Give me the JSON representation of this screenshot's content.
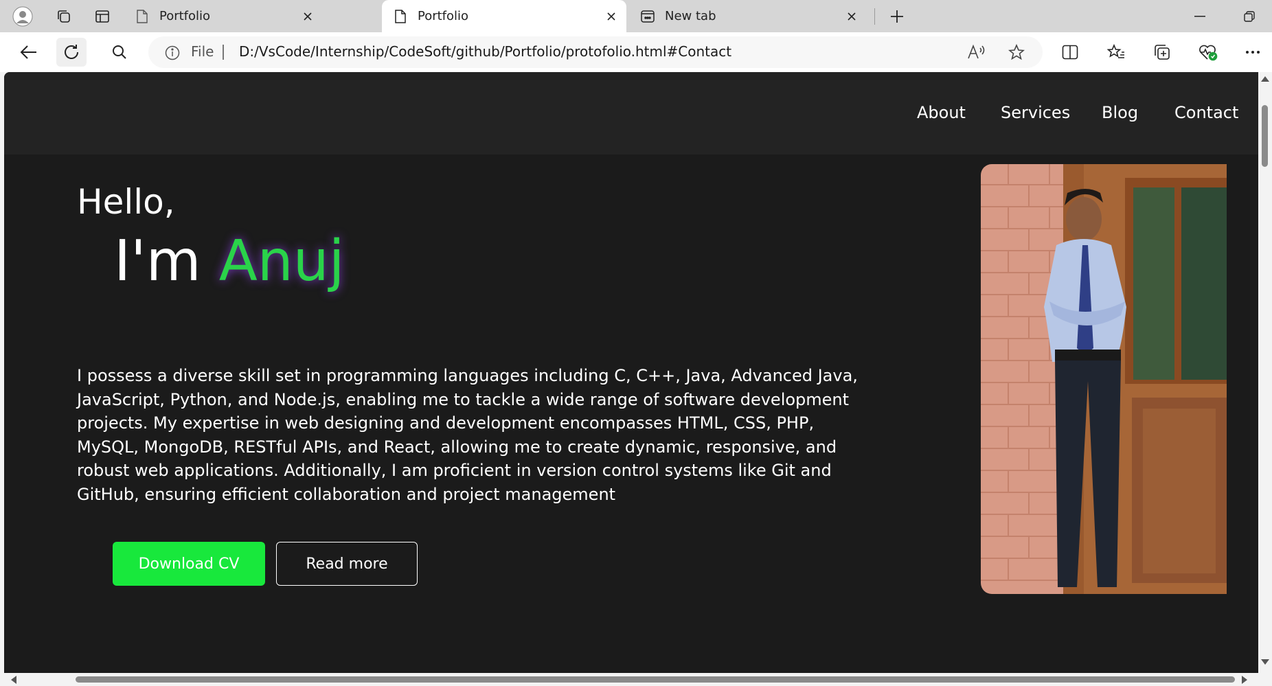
{
  "browser": {
    "tabs": [
      {
        "title": "Portfolio",
        "icon": "page-icon",
        "active": false
      },
      {
        "title": "Portfolio",
        "icon": "page-icon",
        "active": true
      },
      {
        "title": "New tab",
        "icon": "new-tab-page-icon",
        "active": false
      }
    ],
    "address_bar": {
      "protocol_label": "File",
      "url": "D:/VsCode/Internship/CodeSoft/github/Portfolio/protofolio.html#Contact"
    }
  },
  "page": {
    "nav": [
      "About",
      "Services",
      "Blog",
      "Contact"
    ],
    "hero": {
      "greeting": "Hello,",
      "intro_prefix": "I'm",
      "name": "Anuj",
      "bio": "I possess a diverse skill set in programming languages including C, C++, Java, Advanced Java, JavaScript, Python, and Node.js, enabling me to tackle a wide range of software development projects. My expertise in web designing and development encompasses HTML, CSS, PHP, MySQL, MongoDB, RESTful APIs, and React, allowing me to create dynamic, responsive, and robust web applications. Additionally, I am proficient in version control systems like Git and GitHub, ensuring efficient collaboration and project management",
      "primary_button": "Download CV",
      "secondary_button": "Read more"
    },
    "colors": {
      "background": "#1b1b1b",
      "nav_background": "#232323",
      "accent_green": "#18e83c",
      "name_green": "#2ad34a",
      "name_glow": "#9b46ff"
    }
  }
}
